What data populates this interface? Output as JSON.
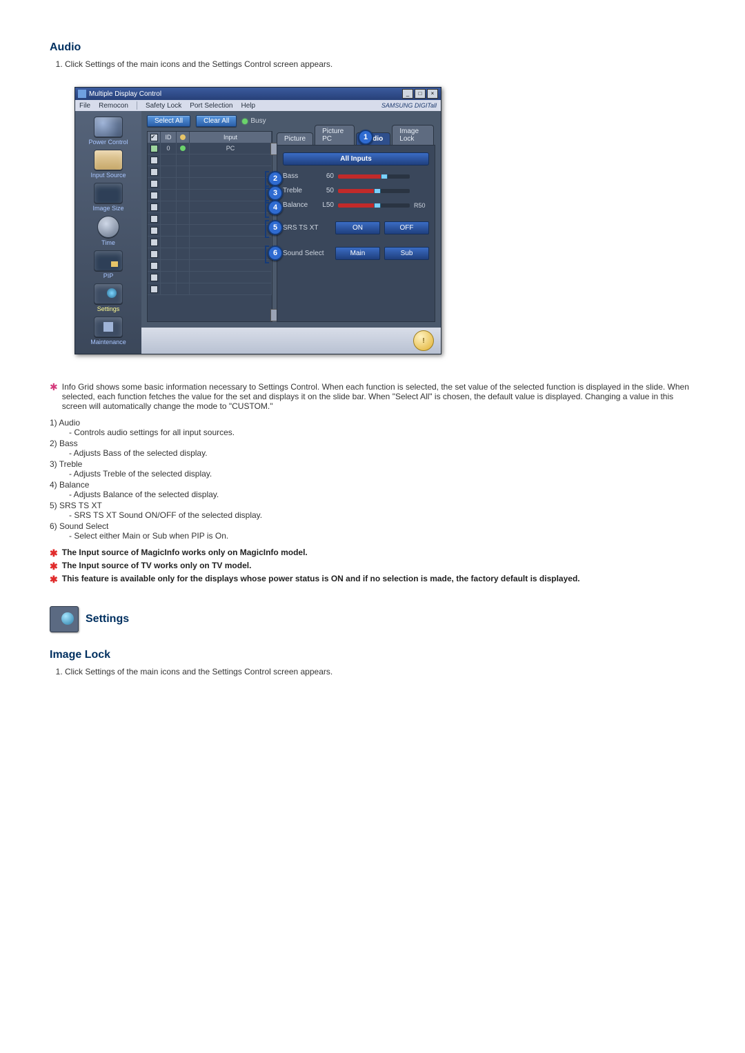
{
  "section1": {
    "title": "Audio",
    "steps": [
      "Click Settings of the main icons and the Settings Control screen appears."
    ]
  },
  "app": {
    "windowTitle": "Multiple Display Control",
    "menu": [
      "File",
      "Remocon",
      "Safety Lock",
      "Port Selection",
      "Help"
    ],
    "brand": "SAMSUNG DIGITall",
    "sidebar": [
      {
        "label": "Power Control"
      },
      {
        "label": "Input Source"
      },
      {
        "label": "Image Size"
      },
      {
        "label": "Time"
      },
      {
        "label": "PIP"
      },
      {
        "label": "Settings"
      },
      {
        "label": "Maintenance"
      }
    ],
    "toolbar": {
      "selectAll": "Select All",
      "clearAll": "Clear All",
      "busy": "Busy"
    },
    "gridHeaders": {
      "id": "ID",
      "input": "Input"
    },
    "gridFirstRow": {
      "id": "0",
      "input": "PC"
    },
    "tabs": [
      "Picture",
      "Picture PC",
      "Audio",
      "Image Lock"
    ],
    "activeTabIndex": 2,
    "allInputs": "All Inputs",
    "sliders": [
      {
        "label": "Bass",
        "value": "60",
        "fill": 60,
        "endLabel": ""
      },
      {
        "label": "Treble",
        "value": "50",
        "fill": 50,
        "endLabel": ""
      },
      {
        "label": "Balance",
        "value": "L50",
        "fill": 50,
        "endLabel": "R50"
      }
    ],
    "toggles": [
      {
        "label": "SRS TS XT",
        "a": "ON",
        "b": "OFF"
      },
      {
        "label": "Sound Select",
        "a": "Main",
        "b": "Sub"
      }
    ],
    "callouts": {
      "1": "1",
      "2": "2",
      "3": "3",
      "4": "4",
      "5": "5",
      "6": "6"
    },
    "footerIcon": "!"
  },
  "infoStarText": "Info Grid shows some basic information necessary to Settings Control. When each function is selected, the set value of the selected function is displayed in the slide. When selected, each function fetches the value for the set and displays it on the slide bar. When \"Select All\" is chosen, the default value is displayed. Changing a value in this screen will automatically change the mode to \"CUSTOM.\"",
  "numbered": [
    {
      "hd": "1)  Audio",
      "sub": "- Controls audio settings for all input sources."
    },
    {
      "hd": "2)  Bass",
      "sub": "- Adjusts Bass of the selected display."
    },
    {
      "hd": "3)  Treble",
      "sub": "- Adjusts Treble of the selected display."
    },
    {
      "hd": "4)  Balance",
      "sub": "- Adjusts Balance of the selected display."
    },
    {
      "hd": "5)  SRS TS XT",
      "sub": "- SRS TS XT Sound ON/OFF of the selected display."
    },
    {
      "hd": "6)  Sound Select",
      "sub": "- Select either Main or Sub when PIP is On."
    }
  ],
  "boldNotes": [
    "The Input source of MagicInfo works only on MagicInfo model.",
    "The Input source of TV works only on TV model.",
    "This feature is available only for the displays whose power status is ON and if no selection is made, the factory default is displayed."
  ],
  "section2Icon": "Settings",
  "section2": {
    "title": "Image Lock",
    "steps": [
      "Click Settings of the main icons and the Settings Control screen appears."
    ]
  }
}
